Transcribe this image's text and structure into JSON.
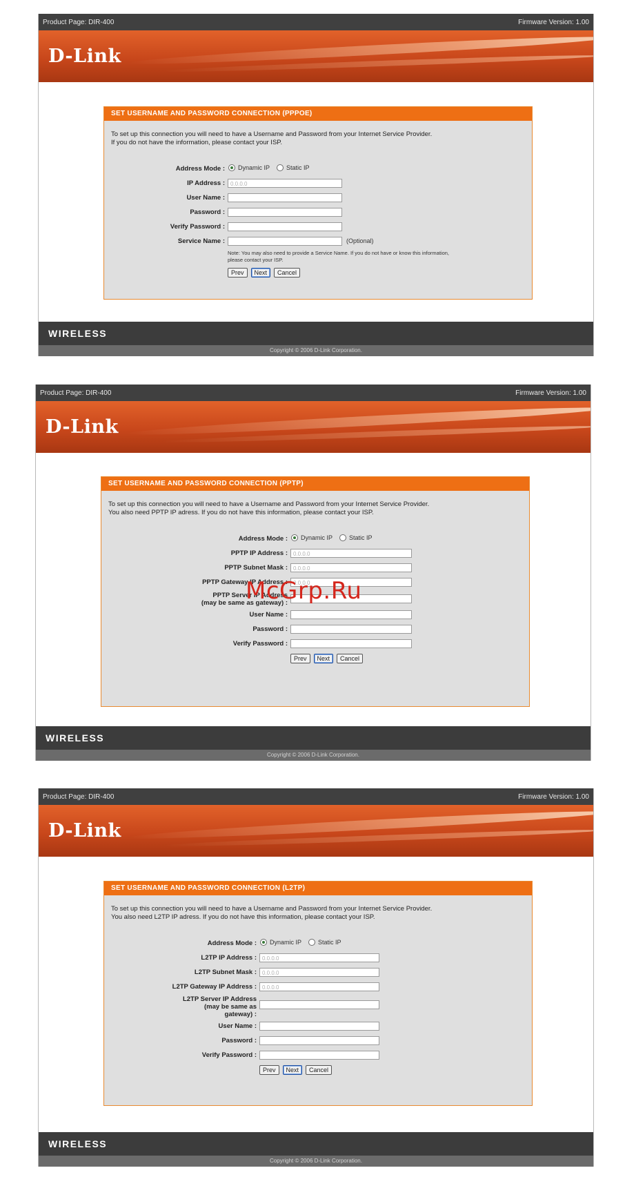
{
  "screens": [
    {
      "product_page": "Product Page: DIR-400",
      "firmware": "Firmware Version: 1.00",
      "logo": "D-Link",
      "title": "SET USERNAME AND PASSWORD CONNECTION (PPPOE)",
      "intro_line1": "To set up this connection you will need to have a Username and Password from your Internet Service Provider.",
      "intro_line2": "If you do not have the information, please contact your ISP.",
      "address_mode_label": "Address Mode :",
      "radio_dynamic": "Dynamic IP",
      "radio_static": "Static IP",
      "fields": [
        {
          "label": "IP Address :",
          "value": "0.0.0.0"
        },
        {
          "label": "User Name :",
          "value": ""
        },
        {
          "label": "Password :",
          "value": ""
        },
        {
          "label": "Verify Password :",
          "value": ""
        },
        {
          "label": "Service Name :",
          "value": ""
        }
      ],
      "optional": "(Optional)",
      "note_line1": "Note: You may also need to provide a Service Name. If you do not have or know this information,",
      "note_line2": "please contact your ISP.",
      "buttons": {
        "prev": "Prev",
        "next": "Next",
        "cancel": "Cancel"
      },
      "footer": "WIRELESS",
      "copyright": "Copyright © 2006 D-Link Corporation."
    },
    {
      "product_page": "Product Page: DIR-400",
      "firmware": "Firmware Version: 1.00",
      "logo": "D-Link",
      "title": "SET USERNAME AND PASSWORD CONNECTION (PPTP)",
      "intro_line1": "To set up this connection you will need to have a Username and Password from your Internet Service Provider.",
      "intro_line2": "You also need PPTP IP adress. If you do not have this information, please contact your ISP.",
      "address_mode_label": "Address Mode :",
      "radio_dynamic": "Dynamic IP",
      "radio_static": "Static IP",
      "fields": [
        {
          "label": "PPTP IP Address :",
          "value": "0.0.0.0"
        },
        {
          "label": "PPTP Subnet Mask :",
          "value": "0.0.0.0"
        },
        {
          "label": "PPTP Gateway IP Address :",
          "value": "0.0.0.0"
        },
        {
          "label": "PPTP Server IP Address",
          "label2": "(may be same as gateway) :",
          "value": ""
        },
        {
          "label": "User Name :",
          "value": ""
        },
        {
          "label": "Password :",
          "value": ""
        },
        {
          "label": "Verify Password :",
          "value": ""
        }
      ],
      "buttons": {
        "prev": "Prev",
        "next": "Next",
        "cancel": "Cancel"
      },
      "footer": "WIRELESS",
      "copyright": "Copyright © 2006 D-Link Corporation."
    },
    {
      "product_page": "Product Page: DIR-400",
      "firmware": "Firmware Version: 1.00",
      "logo": "D-Link",
      "title": "SET USERNAME AND PASSWORD CONNECTION (L2TP)",
      "intro_line1": "To set up this connection you will need to have a Username and Password from your Internet Service Provider.",
      "intro_line2": "You also need L2TP IP adress. If you do not have this information, please contact your ISP.",
      "address_mode_label": "Address Mode :",
      "radio_dynamic": "Dynamic IP",
      "radio_static": "Static IP",
      "fields": [
        {
          "label": "L2TP IP Address :",
          "value": "0.0.0.0"
        },
        {
          "label": "L2TP Subnet Mask :",
          "value": "0.0.0.0"
        },
        {
          "label": "L2TP Gateway IP Address :",
          "value": "0.0.0.0"
        },
        {
          "label": "L2TP Server IP Address",
          "label2": "(may be same as",
          "label3": "gateway) :",
          "value": ""
        },
        {
          "label": "User Name :",
          "value": ""
        },
        {
          "label": "Password :",
          "value": ""
        },
        {
          "label": "Verify Password :",
          "value": ""
        }
      ],
      "buttons": {
        "prev": "Prev",
        "next": "Next",
        "cancel": "Cancel"
      },
      "footer": "WIRELESS",
      "copyright": "Copyright © 2006 D-Link Corporation."
    }
  ],
  "watermark": "McGrp.Ru"
}
